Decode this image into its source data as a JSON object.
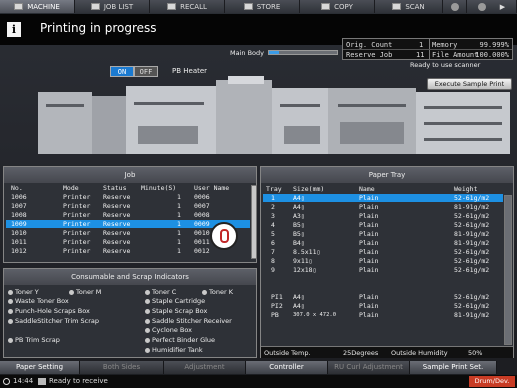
{
  "tabs": [
    {
      "label": "MACHINE",
      "icon": "copier-icon"
    },
    {
      "label": "JOB LIST",
      "icon": "job-list-icon"
    },
    {
      "label": "RECALL",
      "icon": "recall-icon"
    },
    {
      "label": "STORE",
      "icon": "store-icon"
    },
    {
      "label": "COPY",
      "icon": "copy-icon"
    },
    {
      "label": "SCAN",
      "icon": "scan-icon"
    }
  ],
  "header": {
    "title": "Printing in progress",
    "info_icon": "i"
  },
  "status_box": {
    "orig_count_label": "Orig. Count",
    "orig_count": "1",
    "memory_label": "Memory",
    "memory": "99.999%",
    "reserve_label": "Reserve Job",
    "reserve": "11",
    "file_amount_label": "File Amount",
    "file_amount": "100.000%"
  },
  "main_body": {
    "label": "Main Body",
    "progress": 0.15
  },
  "ready_text": "Ready to use scanner",
  "pb_heater": {
    "on": "ON",
    "off": "OFF",
    "label": "PB Heater"
  },
  "sample_print_label": "Execute Sample Print",
  "job_panel": {
    "title": "Job",
    "headers": [
      "No.",
      "Mode",
      "Status",
      "Minute(S)",
      "User Name"
    ],
    "rows": [
      [
        "1006",
        "Printer",
        "Reserve",
        "1",
        "0006"
      ],
      [
        "1007",
        "Printer",
        "Reserve",
        "1",
        "0007"
      ],
      [
        "1008",
        "Printer",
        "Reserve",
        "1",
        "0008"
      ],
      [
        "1009",
        "Printer",
        "Reserve",
        "1",
        "0009"
      ],
      [
        "1010",
        "Printer",
        "Reserve",
        "1",
        "0010"
      ],
      [
        "1011",
        "Printer",
        "Reserve",
        "1",
        "0011"
      ],
      [
        "1012",
        "Printer",
        "Reserve",
        "1",
        "0012"
      ]
    ],
    "selected_index": 3
  },
  "consumable_panel": {
    "title": "Consumable and Scrap Indicators",
    "items": [
      "Toner Y",
      "Toner M",
      "Toner C",
      "Toner K",
      "Waste Toner Box",
      "Staple Cartridge",
      "Punch-Hole Scraps Box",
      "Staple Scrap Box",
      "SaddleStitcher Trim Scrap",
      "Saddle Stitcher Receiver",
      "Cyclone Box",
      "PB Trim Scrap",
      "Perfect Binder Glue",
      "Humidifier Tank"
    ]
  },
  "paper_tray": {
    "title": "Paper Tray",
    "headers": [
      "Tray",
      "Size(mm)",
      "Name",
      "Weight"
    ],
    "rows": [
      [
        "1",
        "A4▯",
        "Plain",
        "52-61g/m2"
      ],
      [
        "2",
        "A4▯",
        "Plain",
        "81-91g/m2"
      ],
      [
        "3",
        "A3▯",
        "Plain",
        "52-61g/m2"
      ],
      [
        "4",
        "B5▯",
        "Plain",
        "52-61g/m2"
      ],
      [
        "5",
        "B5▯",
        "Plain",
        "81-91g/m2"
      ],
      [
        "6",
        "B4▯",
        "Plain",
        "81-91g/m2"
      ],
      [
        "7",
        "8.5x11▯",
        "Plain",
        "52-61g/m2"
      ],
      [
        "8",
        "9x11▯",
        "Plain",
        "52-61g/m2"
      ],
      [
        "9",
        "12x18▯",
        "Plain",
        "52-61g/m2"
      ],
      [
        "PI1",
        "A4▯",
        "Plain",
        "52-61g/m2"
      ],
      [
        "PI2",
        "A4▯",
        "Plain",
        "52-61g/m2"
      ],
      [
        "PB",
        "307.0 x 472.0",
        "Plain",
        "81-91g/m2"
      ]
    ],
    "selected_index": 0,
    "outside_temp_label": "Outside Temp.",
    "outside_temp": "25Degrees",
    "outside_humidity_label": "Outside Humidity",
    "outside_humidity": "50%"
  },
  "bottom_tabs": [
    {
      "label": "Paper Setting",
      "enabled": true
    },
    {
      "label": "Both Sides",
      "enabled": false
    },
    {
      "label": "Adjustment",
      "enabled": false
    },
    {
      "label": "Controller",
      "enabled": true
    },
    {
      "label": "RU Curl Adjustment",
      "enabled": false
    },
    {
      "label": "Sample Print Set.",
      "enabled": true
    }
  ],
  "status_bar": {
    "time": "14:44",
    "message": "Ready to receive",
    "drum_label": "Drum/Dev."
  }
}
